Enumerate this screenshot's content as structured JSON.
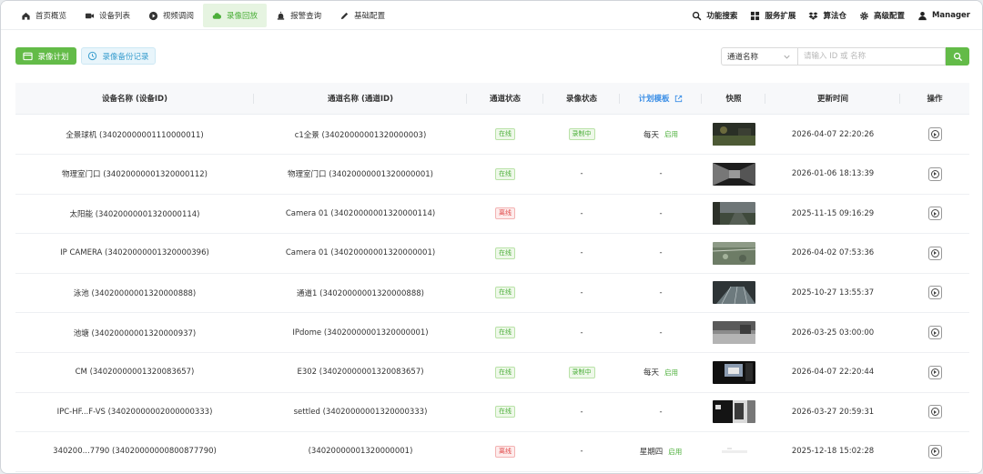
{
  "nav": {
    "left": [
      {
        "label": "首页概览",
        "icon": "home-icon",
        "active": false
      },
      {
        "label": "设备列表",
        "icon": "camera-icon",
        "active": false
      },
      {
        "label": "视频调阅",
        "icon": "play-circle-icon",
        "active": false
      },
      {
        "label": "录像回放",
        "icon": "cloud-icon",
        "active": true
      },
      {
        "label": "报警查询",
        "icon": "alarm-icon",
        "active": false
      },
      {
        "label": "基础配置",
        "icon": "edit-icon",
        "active": false
      }
    ],
    "right": [
      {
        "label": "功能搜索",
        "icon": "search-icon"
      },
      {
        "label": "服务扩展",
        "icon": "grid-icon"
      },
      {
        "label": "算法仓",
        "icon": "dropbox-icon"
      },
      {
        "label": "高级配置",
        "icon": "gear-icon"
      },
      {
        "label": "Manager",
        "icon": "user-icon"
      }
    ]
  },
  "toolbar": {
    "plan_label": "录像计划",
    "backup_label": "录像备份记录",
    "search_field": "通道名称",
    "search_placeholder": "请输入 ID 或 名称"
  },
  "table": {
    "headers": {
      "device": "设备名称 (设备ID)",
      "channel": "通道名称 (通道ID)",
      "channel_status": "通道状态",
      "record_status": "录像状态",
      "plan": "计划模板",
      "snapshot": "快照",
      "updated": "更新时间",
      "ops": "操作"
    },
    "rows": [
      {
        "device": "全景球机 (34020000001110000011)",
        "channel": "c1全景 (34020000001320000003)",
        "channel_status": "在线",
        "online": true,
        "record_status": "录制中",
        "recording": true,
        "plan": "每天",
        "plan_enabled": "启用",
        "thumb": "night-square",
        "updated": "2026-04-07 22:20:26"
      },
      {
        "device": "物理室门口 (34020000001320000112)",
        "channel": "物理室门口 (34020000001320000001)",
        "channel_status": "在线",
        "online": true,
        "record_status": "-",
        "recording": false,
        "plan": "-",
        "plan_enabled": "",
        "thumb": "corridor",
        "updated": "2026-01-06 18:13:39"
      },
      {
        "device": "太阳能 (34020000001320000114)",
        "channel": "Camera 01 (34020000001320000114)",
        "channel_status": "离线",
        "online": false,
        "record_status": "-",
        "recording": false,
        "plan": "-",
        "plan_enabled": "",
        "thumb": "field",
        "updated": "2025-11-15 09:16:29"
      },
      {
        "device": "IP CAMERA (34020000001320000396)",
        "channel": "Camera 01 (34020000001320000001)",
        "channel_status": "在线",
        "online": true,
        "record_status": "-",
        "recording": false,
        "plan": "-",
        "plan_enabled": "",
        "thumb": "grass",
        "updated": "2026-04-02 07:53:36"
      },
      {
        "device": "泳池 (34020000001320000888)",
        "channel": "通道1 (34020000001320000888)",
        "channel_status": "在线",
        "online": true,
        "record_status": "-",
        "recording": false,
        "plan": "-",
        "plan_enabled": "",
        "thumb": "pool",
        "updated": "2025-10-27 13:55:37"
      },
      {
        "device": "池塘 (34020000001320000937)",
        "channel": "IPdome (34020000001320000001)",
        "channel_status": "在线",
        "online": true,
        "record_status": "-",
        "recording": false,
        "plan": "-",
        "plan_enabled": "",
        "thumb": "pond",
        "updated": "2026-03-25 03:00:00"
      },
      {
        "device": "CM (34020000001320083657)",
        "channel": "E302 (34020000001320083657)",
        "channel_status": "在线",
        "online": true,
        "record_status": "录制中",
        "recording": true,
        "plan": "每天",
        "plan_enabled": "启用",
        "thumb": "room",
        "updated": "2026-04-07 22:20:44"
      },
      {
        "device": "IPC-HF...F-VS (34020000002000000333)",
        "channel": "settled (34020000001320000333)",
        "channel_status": "在线",
        "online": true,
        "record_status": "-",
        "recording": false,
        "plan": "-",
        "plan_enabled": "",
        "thumb": "bw",
        "updated": "2026-03-27 20:59:31"
      },
      {
        "device": "340200...7790 (34020000000800877790)",
        "channel": "(34020000001320000001)",
        "channel_status": "离线",
        "online": false,
        "record_status": "-",
        "recording": false,
        "plan": "星期四",
        "plan_enabled": "启用",
        "thumb": "faint",
        "updated": "2025-12-18 15:02:28"
      }
    ]
  }
}
